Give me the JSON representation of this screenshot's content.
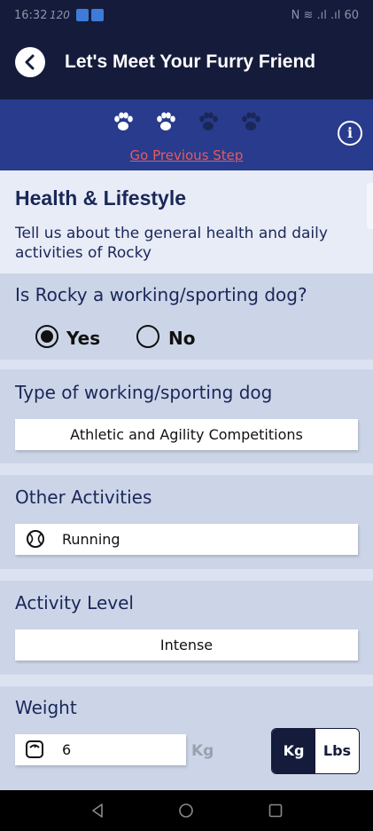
{
  "status_bar": {
    "time": "16:32",
    "net_speed": "120",
    "right_indicators": "N ≋ .ıl .ıl 60"
  },
  "header": {
    "title": "Let's Meet Your Furry Friend",
    "back_icon": "chevron-left-icon"
  },
  "stepper": {
    "link": "Go Previous Step",
    "steps_total": 4,
    "steps_done": 2,
    "info_icon": "info-icon"
  },
  "intro": {
    "heading": "Health & Lifestyle",
    "description": "Tell us about the general health and daily activities of Rocky"
  },
  "working_dog": {
    "question": "Is Rocky a working/sporting dog?",
    "options": [
      "Yes",
      "No"
    ],
    "selected": "Yes"
  },
  "working_type": {
    "label": "Type of working/sporting dog",
    "value": "Athletic and Agility Competitions"
  },
  "other_activities": {
    "label": "Other Activities",
    "value": "Running",
    "icon": "tennis-ball-icon"
  },
  "activity_level": {
    "label": "Activity Level",
    "value": "Intense"
  },
  "weight": {
    "label": "Weight",
    "value": "6",
    "unit_suffix": "Kg",
    "units": [
      "Kg",
      "Lbs"
    ],
    "selected_unit": "Kg",
    "icon": "scale-icon"
  },
  "colors": {
    "dark_navy": "#151b3b",
    "royal_blue": "#283b8c",
    "link_red": "#e45b62",
    "section_bg": "#ccd5e8",
    "intro_bg": "#e8ecf7"
  }
}
